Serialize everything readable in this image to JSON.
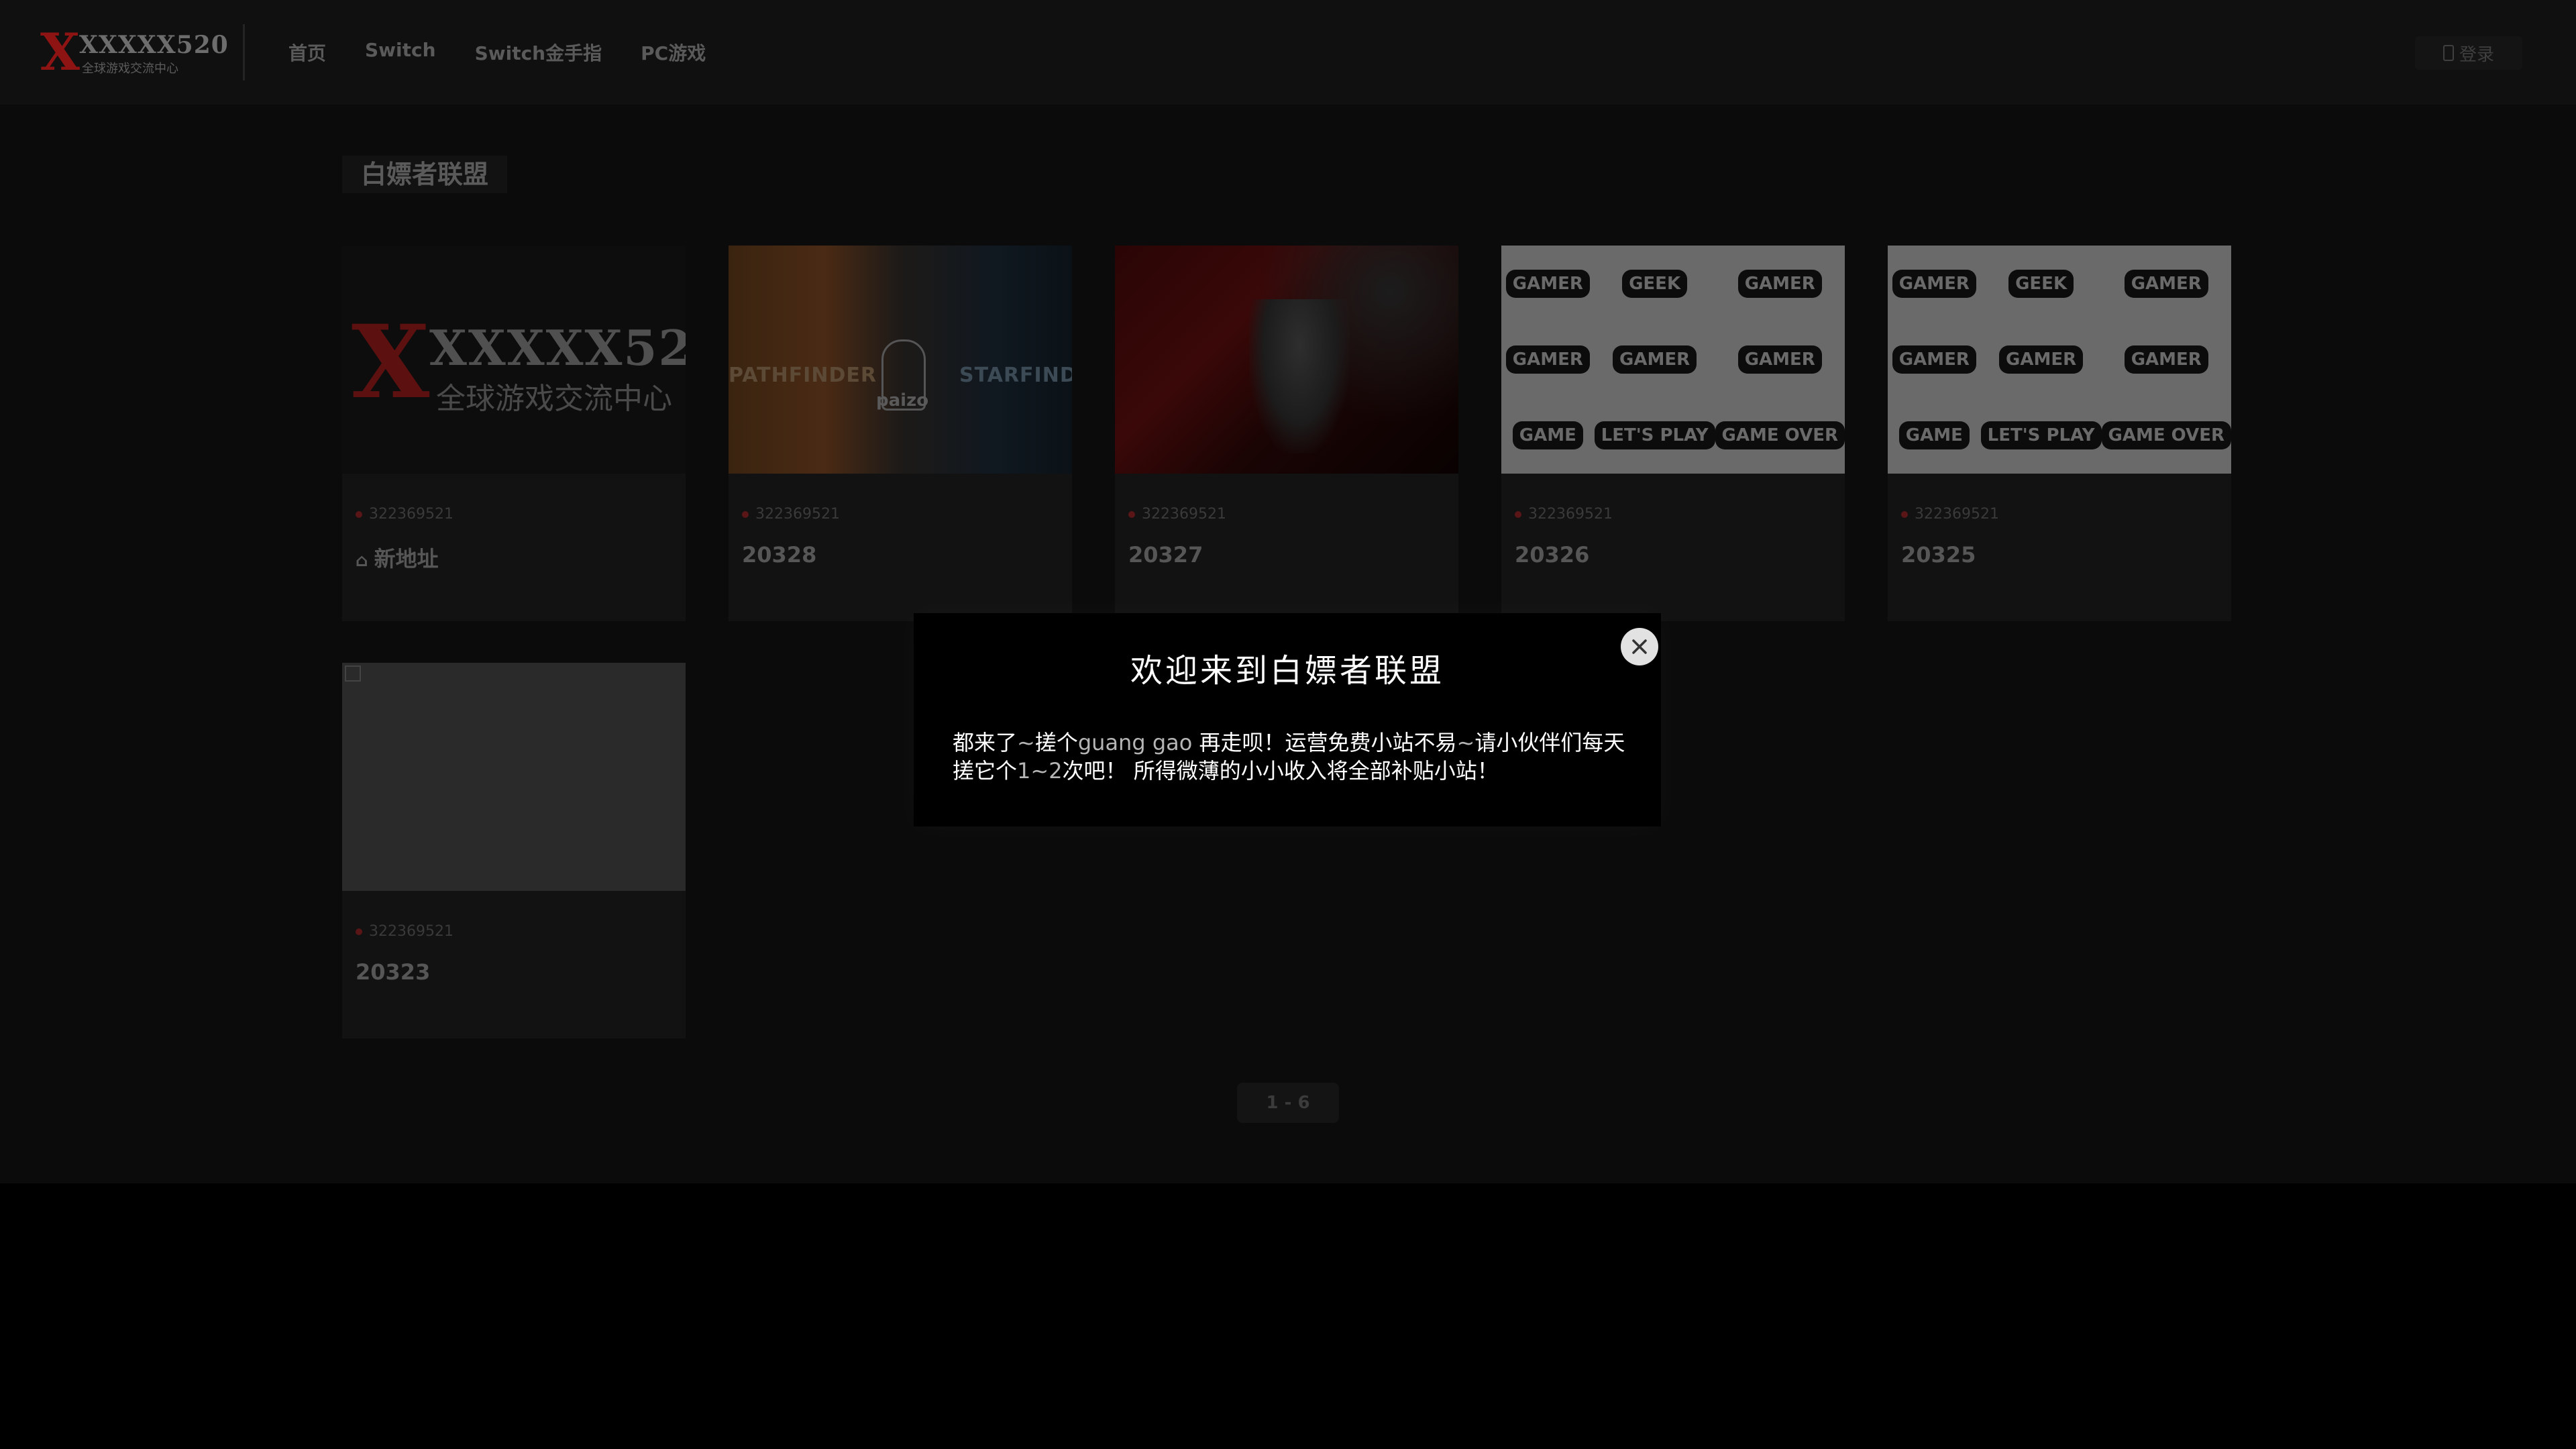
{
  "header": {
    "logo": {
      "x": "X",
      "brand": "XXXXX520",
      "tagline": "全球游戏交流中心"
    },
    "nav": [
      "首页",
      "Switch",
      "Switch金手指",
      "PC游戏"
    ],
    "login_label": "登录"
  },
  "section": {
    "title": "白嫖者联盟"
  },
  "cards": [
    {
      "user": "322369521",
      "title": "新地址",
      "image_icon": "logo-image"
    },
    {
      "user": "322369521",
      "title": "20328",
      "image_icon": "pathfinder-image",
      "image_text": {
        "left": "PATHFINDER",
        "center": "paizo",
        "right": "STARFINDER"
      }
    },
    {
      "user": "322369521",
      "title": "20327",
      "image_icon": "soldier-image"
    },
    {
      "user": "322369521",
      "title": "20326",
      "image_icon": "gamer-badges-image"
    },
    {
      "user": "322369521",
      "title": "20325",
      "image_icon": "gamer-badges-image"
    },
    {
      "user": "322369521",
      "title": "20323",
      "image_icon": "broken-image"
    }
  ],
  "gamer_badges": [
    "GAMER",
    "GEEK",
    "GAMER",
    "GAMER",
    "GAMER",
    "GAMER",
    "GAME",
    "LET'S PLAY",
    "GAME OVER"
  ],
  "pagination": {
    "label": "1 - 6"
  },
  "modal": {
    "title": "欢迎来到白嫖者联盟",
    "body_parts": [
      {
        "text": "都来了",
        "hl": false
      },
      {
        "text": "~",
        "hl": true
      },
      {
        "text": "搓个",
        "hl": false
      },
      {
        "text": "guang gao ",
        "hl": true
      },
      {
        "text": "再走呗！运营免费小站不易",
        "hl": false
      },
      {
        "text": "~",
        "hl": true
      },
      {
        "text": "请小伙伴们每天搓它个",
        "hl": false
      },
      {
        "text": "1~2",
        "hl": true
      },
      {
        "text": "次吧！ 所得微薄的小小收入将全部补贴小站！",
        "hl": false
      }
    ],
    "close_icon": "close-icon"
  },
  "colors": {
    "background": "#0b0b0b",
    "accent_red": "#8e1414",
    "modal_bg": "#000000"
  }
}
